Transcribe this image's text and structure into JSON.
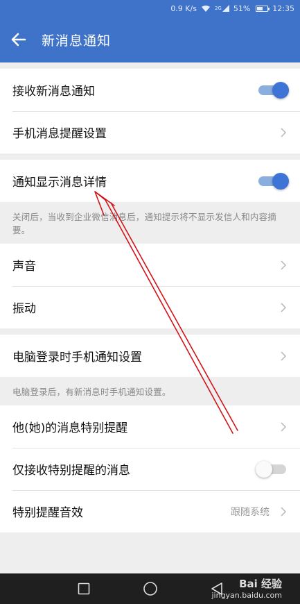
{
  "statusbar": {
    "speed": "0.9 K/s",
    "network_badge": "2G",
    "battery": "51%",
    "battery_level": 0.51,
    "time": "12:35"
  },
  "appbar": {
    "back_icon": "arrow-left-icon",
    "title": "新消息通知"
  },
  "settings": {
    "receive_new": {
      "label": "接收新消息通知",
      "enabled": true
    },
    "phone_reminder": {
      "label": "手机消息提醒设置"
    },
    "show_details": {
      "label": "通知显示消息详情",
      "enabled": true
    },
    "show_details_hint": "关闭后，当收到企业微信消息后，通知提示将不显示发信人和内容摘要。",
    "sound": {
      "label": "声音"
    },
    "vibrate": {
      "label": "振动"
    },
    "pc_login": {
      "label": "电脑登录时手机通知设置"
    },
    "pc_login_hint": "电脑登录后，有新消息时手机通知设置。",
    "special_remind": {
      "label": "他(她)的消息特别提醒"
    },
    "only_special": {
      "label": "仅接收特别提醒的消息",
      "enabled": false
    },
    "special_sound": {
      "label": "特别提醒音效",
      "value": "跟随系统"
    }
  },
  "colors": {
    "primary": "#3f72c9",
    "toggle_on": "#3d74d6",
    "annotation_arrow": "#d0141a"
  },
  "navbar": {
    "buttons": [
      "recent-apps-square-icon",
      "home-circle-icon",
      "back-triangle-icon"
    ]
  },
  "watermark": {
    "brand": "Bai 经验",
    "url": "jingyan.baidu.com"
  }
}
